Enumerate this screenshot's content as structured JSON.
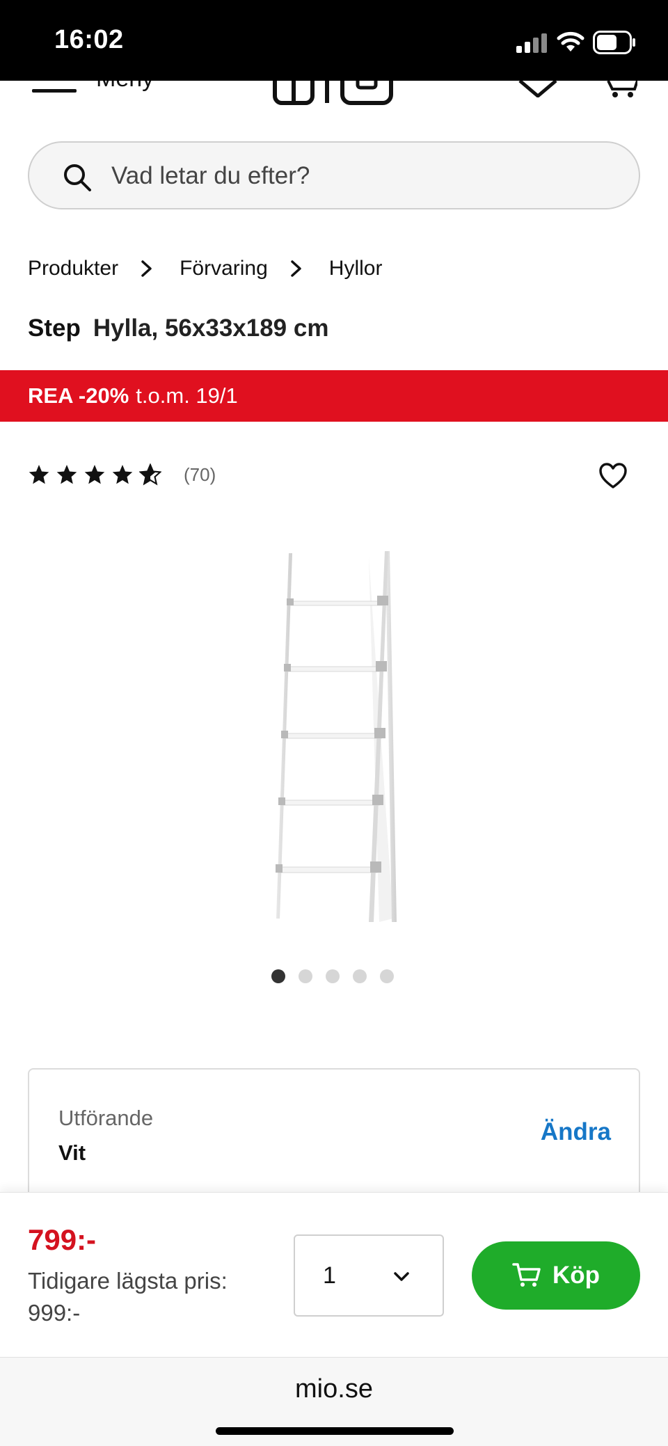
{
  "status_bar": {
    "time": "16:02",
    "icons": [
      "signal-icon",
      "wifi-icon",
      "battery-icon"
    ]
  },
  "header": {
    "menu_label": "Meny",
    "logo_text": "mio",
    "icons": [
      "menu-icon",
      "heart-icon",
      "cart-icon"
    ]
  },
  "search": {
    "placeholder": "Vad letar du efter?"
  },
  "breadcrumb": [
    "Produkter",
    "Förvaring",
    "Hyllor"
  ],
  "product": {
    "brand": "Step",
    "description": "Hylla, 56x33x189 cm",
    "rating": 4.5,
    "rating_max": 5,
    "review_count": "(70)",
    "image_count": 5,
    "active_image_index": 0
  },
  "promo": {
    "bold": "REA -20%",
    "rest": "t.o.m. 19/1",
    "color": "#e0101f"
  },
  "variant": {
    "label": "Utförande",
    "value": "Vit",
    "change_label": "Ändra"
  },
  "buy": {
    "price": "799:-",
    "previous_label": "Tidigare lägsta pris:",
    "previous_price": "999:-",
    "quantity": "1",
    "button_label": "Köp",
    "button_color": "#1fac2a",
    "price_color": "#d4121f"
  },
  "browser": {
    "url": "mio.se"
  }
}
